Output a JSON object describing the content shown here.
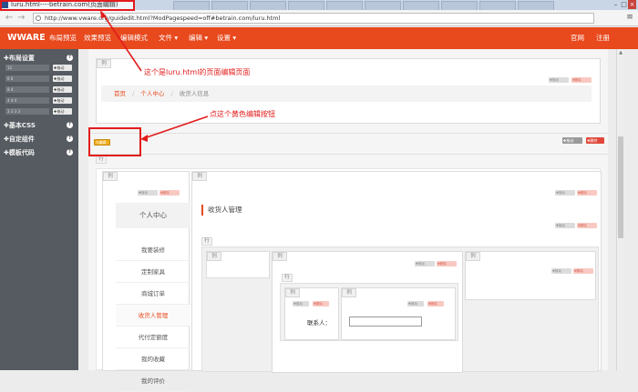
{
  "browser": {
    "tab_title": "luru.html----betrain.com(页面编辑)",
    "url": "http://www.vware.org/guidedit.html?ModPagespeed=off#betrain.com/luru.html",
    "window_buttons": [
      "–",
      "□",
      "×"
    ]
  },
  "navbar": {
    "brand": "WWARE",
    "items": [
      {
        "label": "布局预览"
      },
      {
        "label": "效果预览"
      },
      {
        "label": "编辑模式"
      },
      {
        "label": "文件 ▾"
      },
      {
        "label": "编辑 ▾"
      },
      {
        "label": "设置 ▾"
      }
    ],
    "right": [
      {
        "label": "官网"
      },
      {
        "label": "注册"
      }
    ],
    "color": "#e8491d"
  },
  "sidebar": {
    "sections": [
      {
        "label": "✚布局设置"
      },
      {
        "label": "✚基本CSS"
      },
      {
        "label": "✚自定组件"
      },
      {
        "label": "✚模板代码"
      }
    ],
    "help_glyph": "?",
    "rows": [
      "12",
      "6 6",
      "8 4",
      "4 4 4",
      "3 3 3 3"
    ],
    "drag_label": "✚拖动"
  },
  "annotations": {
    "edit_page": "这个是luru.html的页面编辑页面",
    "edit_button": "点这个黄色编辑按钮",
    "color": "#e31b1b"
  },
  "editor": {
    "col_label": "列",
    "row_label": "行",
    "copy_label": "✚拖动",
    "delete_label": "✖删除",
    "edit_label": "✎编辑",
    "breadcrumb": {
      "home": "首页",
      "sep": "/",
      "center": "个人中心",
      "current": "收货人信息"
    },
    "left_nav_title": "个人中心",
    "left_nav_items": [
      {
        "label": "我要装修"
      },
      {
        "label": "定制家具"
      },
      {
        "label": "商城订单"
      },
      {
        "label": "收货人管理"
      },
      {
        "label": "代付定额度"
      },
      {
        "label": "我的收藏"
      },
      {
        "label": "我的评价"
      }
    ],
    "section_title": "收货人管理",
    "contact_label": "联系人：",
    "contact_value": ""
  }
}
